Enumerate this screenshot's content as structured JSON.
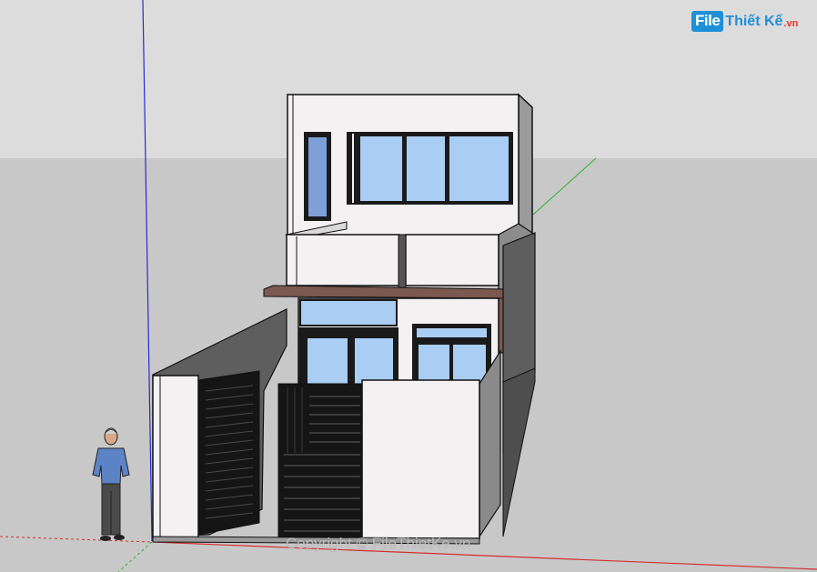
{
  "logo": {
    "badge": "File",
    "name": "Thiết Kế",
    "domain": ".vn"
  },
  "watermark": "Copyright © FileThietKe.vn",
  "colors": {
    "sky": "#dcdcdc",
    "ground": "#c8c8c8",
    "wall_white": "#f4f1f3",
    "wall_dark": "#5e5e5e",
    "glass": "#a9cdf3",
    "frame": "#1a1a1a",
    "canopy": "#7b5950",
    "axis_red": "#d23030",
    "axis_green": "#2fb32f",
    "axis_blue": "#2a2ad4",
    "logo_blue": "#1e90d8",
    "logo_red": "#e8322b"
  }
}
